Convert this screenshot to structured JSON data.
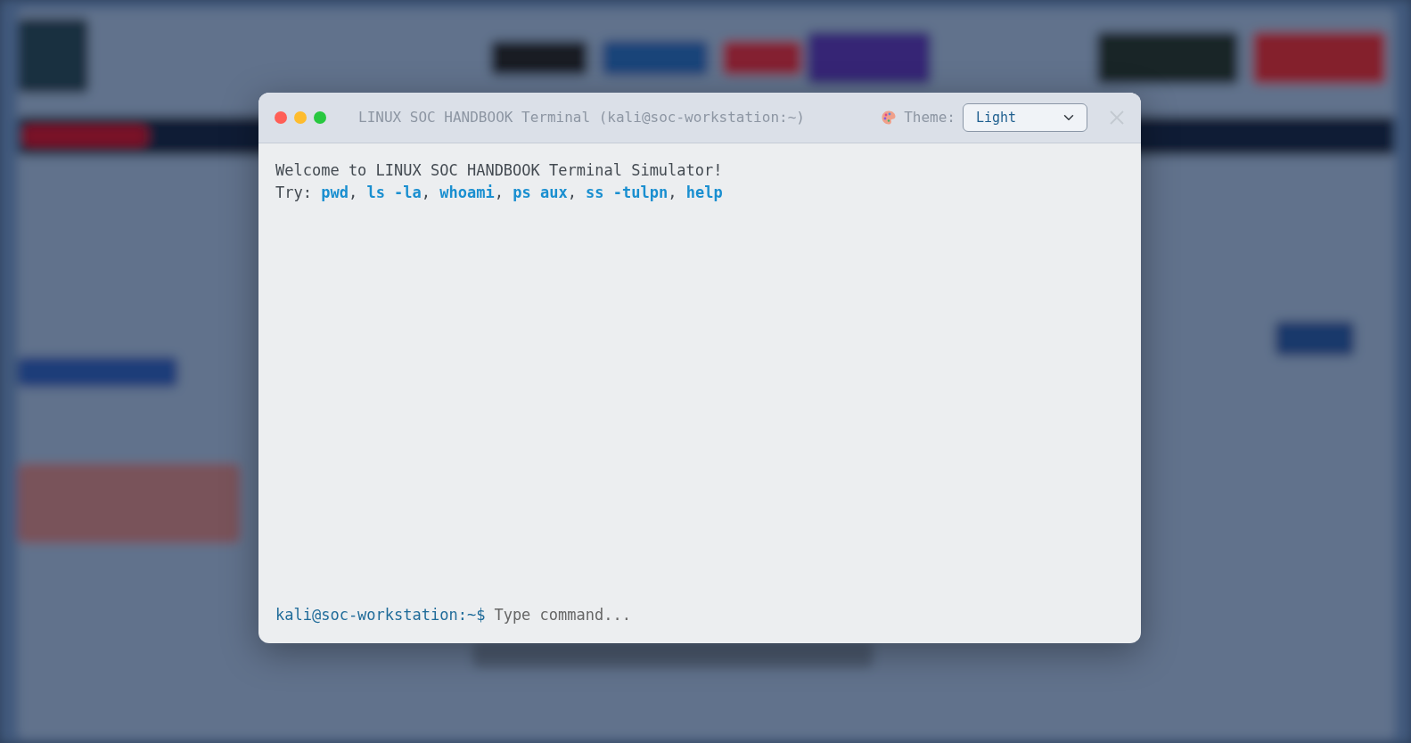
{
  "window": {
    "title": "LINUX SOC HANDBOOK Terminal (kali@soc-workstation:~)",
    "controls": [
      {
        "color": "#ff5f57"
      },
      {
        "color": "#febc2e"
      },
      {
        "color": "#28c840"
      }
    ],
    "theme_label": "Theme:",
    "theme_select": {
      "value": "Light"
    }
  },
  "terminal": {
    "lines": [
      "Welcome to LINUX SOC HANDBOOK Terminal Simulator!",
      "Try: **pwd**, **ls -la**, **whoami**, **ps aux**, **ss -tulpn**, **help**"
    ],
    "prompt": "kali@soc-workstation:~$",
    "input": {
      "placeholder": "Type command..."
    }
  }
}
